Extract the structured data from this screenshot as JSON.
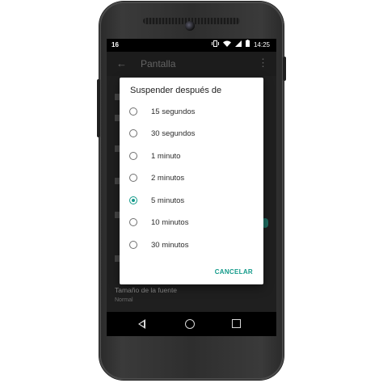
{
  "status_bar": {
    "left_text": "16",
    "time": "14:25",
    "icons": [
      "vibrate-icon",
      "wifi-icon",
      "signal-icon",
      "battery-icon"
    ]
  },
  "app_bar": {
    "title": "Pantalla",
    "back_icon": "back-arrow-icon",
    "menu_icon": "overflow-menu-icon"
  },
  "background_settings": {
    "footer_title": "Tamaño de la fuente",
    "footer_value": "Normal"
  },
  "dialog": {
    "title": "Suspender después de",
    "options": [
      {
        "label": "15 segundos",
        "selected": false
      },
      {
        "label": "30 segundos",
        "selected": false
      },
      {
        "label": "1 minuto",
        "selected": false
      },
      {
        "label": "2 minutos",
        "selected": false
      },
      {
        "label": "5 minutos",
        "selected": true
      },
      {
        "label": "10 minutos",
        "selected": false
      },
      {
        "label": "30 minutos",
        "selected": false
      }
    ],
    "cancel_label": "CANCELAR"
  },
  "nav_bar": {
    "icons": [
      "nav-back-icon",
      "nav-home-icon",
      "nav-recents-icon"
    ]
  },
  "colors": {
    "accent": "#139a8a",
    "dialog_background": "#ffffff",
    "screen_background": "#303030"
  }
}
